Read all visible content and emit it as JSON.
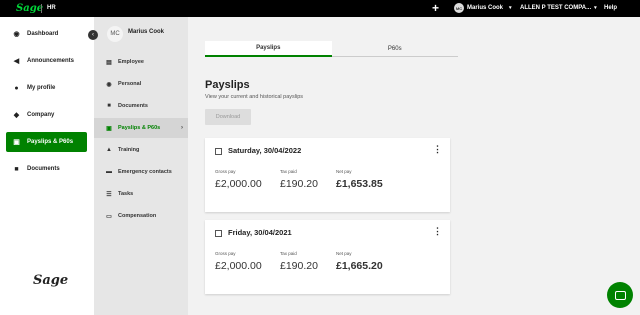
{
  "topbar": {
    "logo": "Sage",
    "app_name": "HR",
    "add": "+",
    "user_initials": "MC",
    "user_name": "Marius Cook",
    "company": "ALLEN P TEST COMPA...",
    "help": "Help",
    "chevron": "▾"
  },
  "left_nav": {
    "items": [
      {
        "label": "Dashboard",
        "icon": "dashboard-icon",
        "glyph": "◉"
      },
      {
        "label": "Announcements",
        "icon": "megaphone-icon",
        "glyph": "◀"
      },
      {
        "label": "My profile",
        "icon": "user-icon",
        "glyph": "●"
      },
      {
        "label": "Company",
        "icon": "people-icon",
        "glyph": "◆"
      },
      {
        "label": "Payslips & P60s",
        "icon": "payslip-icon",
        "glyph": "▣"
      },
      {
        "label": "Documents",
        "icon": "folder-icon",
        "glyph": "■"
      }
    ],
    "footer_logo": "Sage"
  },
  "sub_nav": {
    "collapse_glyph": "‹",
    "employee_initials": "MC",
    "employee_name": "Marius Cook",
    "items": [
      {
        "label": "Employee",
        "icon": "briefcase-icon",
        "glyph": "▤"
      },
      {
        "label": "Personal",
        "icon": "eye-icon",
        "glyph": "◉"
      },
      {
        "label": "Documents",
        "icon": "folder-icon",
        "glyph": "■"
      },
      {
        "label": "Payslips & P60s",
        "icon": "payslip-icon",
        "glyph": "▣"
      },
      {
        "label": "Training",
        "icon": "graduation-cap-icon",
        "glyph": "▲"
      },
      {
        "label": "Emergency contacts",
        "icon": "car-icon",
        "glyph": "▬"
      },
      {
        "label": "Tasks",
        "icon": "list-icon",
        "glyph": "☰"
      },
      {
        "label": "Compensation",
        "icon": "money-icon",
        "glyph": "▭"
      }
    ],
    "active_arrow": "›"
  },
  "main": {
    "tabs": [
      {
        "label": "Payslips"
      },
      {
        "label": "P60s"
      }
    ],
    "title": "Payslips",
    "subtitle": "View your current and historical payslips",
    "download_label": "Download",
    "payslips": [
      {
        "date": "Saturday, 30/04/2022",
        "gross_label": "Gross pay",
        "gross": "£2,000.00",
        "tax_label": "Tax paid",
        "tax": "£190.20",
        "net_label": "Net pay",
        "net": "£1,653.85"
      },
      {
        "date": "Friday, 30/04/2021",
        "gross_label": "Gross pay",
        "gross": "£2,000.00",
        "tax_label": "Tax paid",
        "tax": "£190.20",
        "net_label": "Net pay",
        "net": "£1,665.20"
      }
    ],
    "more_glyph": "⋮"
  },
  "colors": {
    "brand_green": "#008200",
    "topbar_bg": "#000000",
    "logo_green": "#00d639"
  }
}
